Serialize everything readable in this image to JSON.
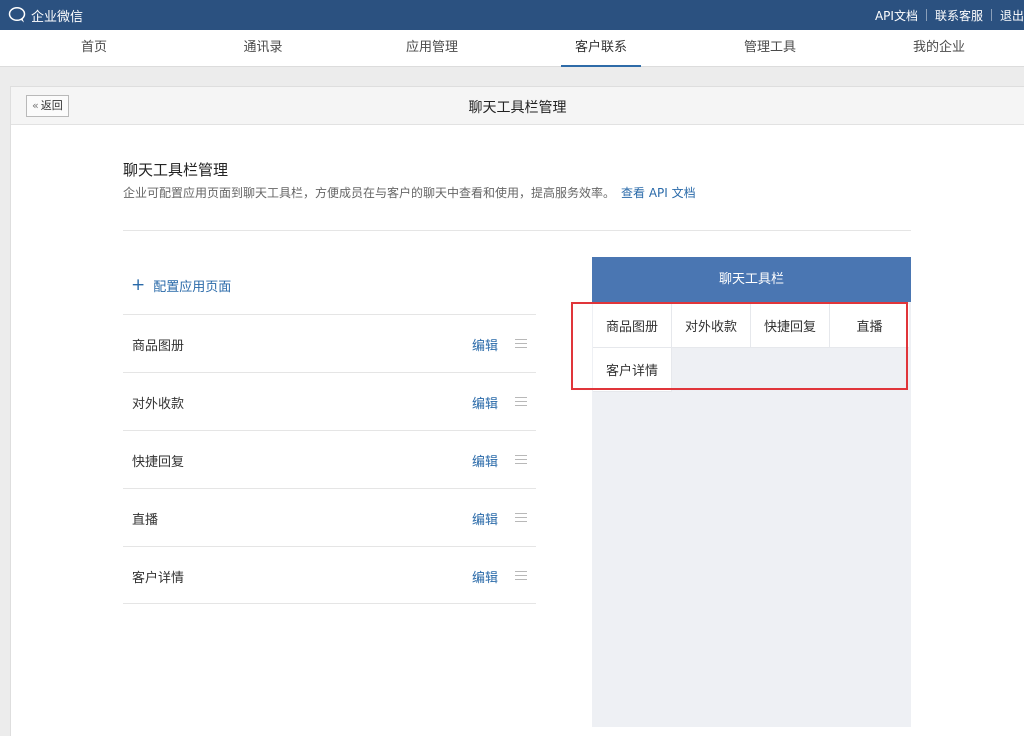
{
  "topbar": {
    "app_name": "企业微信",
    "links": [
      {
        "label": "API文档"
      },
      {
        "label": "联系客服"
      },
      {
        "label": "退出"
      }
    ]
  },
  "nav": {
    "items": [
      {
        "label": "首页",
        "active": false
      },
      {
        "label": "通讯录",
        "active": false
      },
      {
        "label": "应用管理",
        "active": false
      },
      {
        "label": "客户联系",
        "active": true
      },
      {
        "label": "管理工具",
        "active": false
      },
      {
        "label": "我的企业",
        "active": false
      }
    ]
  },
  "panel": {
    "back_label": "返回",
    "title": "聊天工具栏管理"
  },
  "section": {
    "title": "聊天工具栏管理",
    "description": "企业可配置应用页面到聊天工具栏，方便成员在与客户的聊天中查看和使用，提高服务效率。",
    "doc_link": "查看 API 文档"
  },
  "config": {
    "add_label": "配置应用页面",
    "edit_label": "编辑",
    "items": [
      {
        "name": "商品图册"
      },
      {
        "name": "对外收款"
      },
      {
        "name": "快捷回复"
      },
      {
        "name": "直播"
      },
      {
        "name": "客户详情"
      }
    ]
  },
  "preview": {
    "header": "聊天工具栏",
    "tools": [
      {
        "label": "商品图册"
      },
      {
        "label": "对外收款"
      },
      {
        "label": "快捷回复"
      },
      {
        "label": "直播"
      },
      {
        "label": "客户详情"
      }
    ]
  },
  "colors": {
    "topbar": "#2b5180",
    "accent": "#2a6aa9",
    "preview_header": "#4a76b2",
    "highlight": "#e0353a"
  }
}
